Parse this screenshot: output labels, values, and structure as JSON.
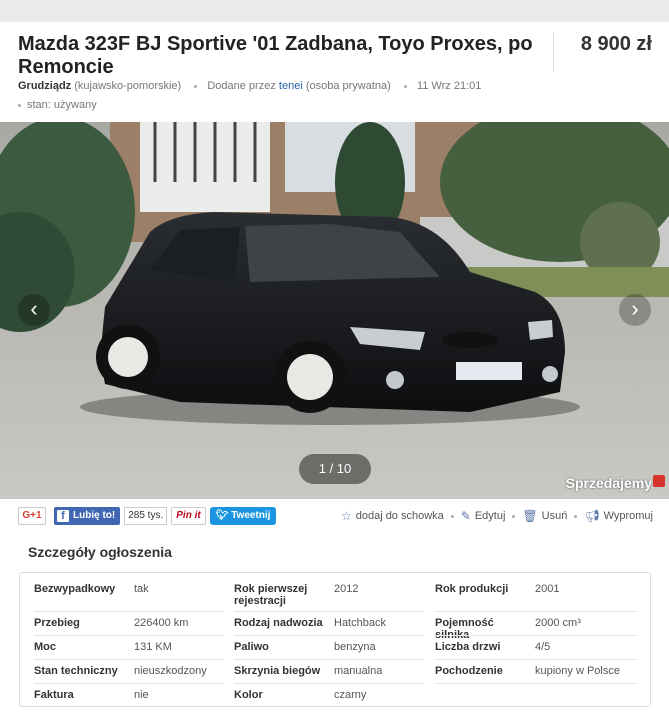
{
  "listing": {
    "title": "Mazda 323F BJ Sportive '01 Zadbana, Toyo Proxes, po Remoncie",
    "price": "8 900 zł",
    "location_city": "Grudziądz",
    "location_region": "(kujawsko-pomorskie)",
    "added_prefix": "Dodane przez",
    "seller": "tenei",
    "seller_type": "(osoba prywatna)",
    "date": "11 Wrz 21:01",
    "condition": "stan: używany"
  },
  "gallery": {
    "counter": "1 / 10",
    "prev_icon": "chevron-left-icon",
    "next_icon": "chevron-right-icon",
    "watermark": "Sprzedajemy"
  },
  "social": {
    "gplus_label": "G+1",
    "fb_like_label": "Lubię to!",
    "fb_count": "285 tys.",
    "pin_label": "Pin it",
    "tweet_label": "Tweetnij"
  },
  "actions": {
    "save_label": "dodaj do schowka",
    "edit_label": "Edytuj",
    "delete_label": "Usuń",
    "promote_label": "Wypromuj"
  },
  "details": {
    "heading": "Szczegóły ogłoszenia",
    "rows": [
      [
        {
          "label": "Bezwypadkowy",
          "value": "tak"
        },
        {
          "label": "Rok pierwszej rejestracji",
          "value": "2012"
        },
        {
          "label": "Rok produkcji",
          "value": "2001"
        }
      ],
      [
        {
          "label": "Przebieg",
          "value": "226400 km"
        },
        {
          "label": "Rodzaj nadwozia",
          "value": "Hatchback"
        },
        {
          "label": "Pojemność silnika",
          "value": "2000 cm³"
        }
      ],
      [
        {
          "label": "Moc",
          "value": "131 KM"
        },
        {
          "label": "Paliwo",
          "value": "benzyna"
        },
        {
          "label": "Liczba drzwi",
          "value": "4/5"
        }
      ],
      [
        {
          "label": "Stan techniczny",
          "value": "nieuszkodzony"
        },
        {
          "label": "Skrzynia biegów",
          "value": "manualna"
        },
        {
          "label": "Pochodzenie",
          "value": "kupiony w Polsce"
        }
      ],
      [
        {
          "label": "Faktura",
          "value": "nie"
        },
        {
          "label": "Kolor",
          "value": "czarny"
        }
      ]
    ]
  }
}
